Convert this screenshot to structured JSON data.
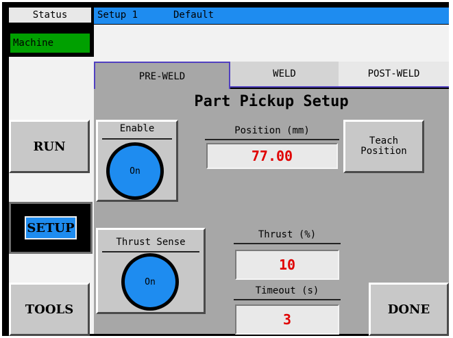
{
  "sidebar": {
    "status_label": "Status",
    "machine_label": "Machine",
    "run_label": "RUN",
    "setup_label": "SETUP",
    "tools_label": "TOOLS"
  },
  "header": {
    "setup_name": "Setup 1",
    "setup_mode": "Default"
  },
  "tabs": [
    {
      "label": "PRE-WELD",
      "active": true
    },
    {
      "label": "WELD",
      "active": false
    },
    {
      "label": "POST-WELD",
      "active": false
    }
  ],
  "page": {
    "title": "Part Pickup Setup"
  },
  "enable": {
    "label": "Enable",
    "state": "On"
  },
  "position": {
    "label": "Position (mm)",
    "value": "77.00"
  },
  "teach": {
    "line1": "Teach",
    "line2": "Position"
  },
  "thrust_sense": {
    "label": "Thrust Sense",
    "state": "On"
  },
  "thrust": {
    "label": "Thrust (%)",
    "value": "10"
  },
  "timeout": {
    "label": "Timeout (s)",
    "value": "3"
  },
  "done_label": "DONE",
  "colors": {
    "header_blue": "#1e8cf0",
    "machine_green": "#00a000",
    "panel_gray": "#a7a7a7",
    "value_red": "#e00000"
  }
}
